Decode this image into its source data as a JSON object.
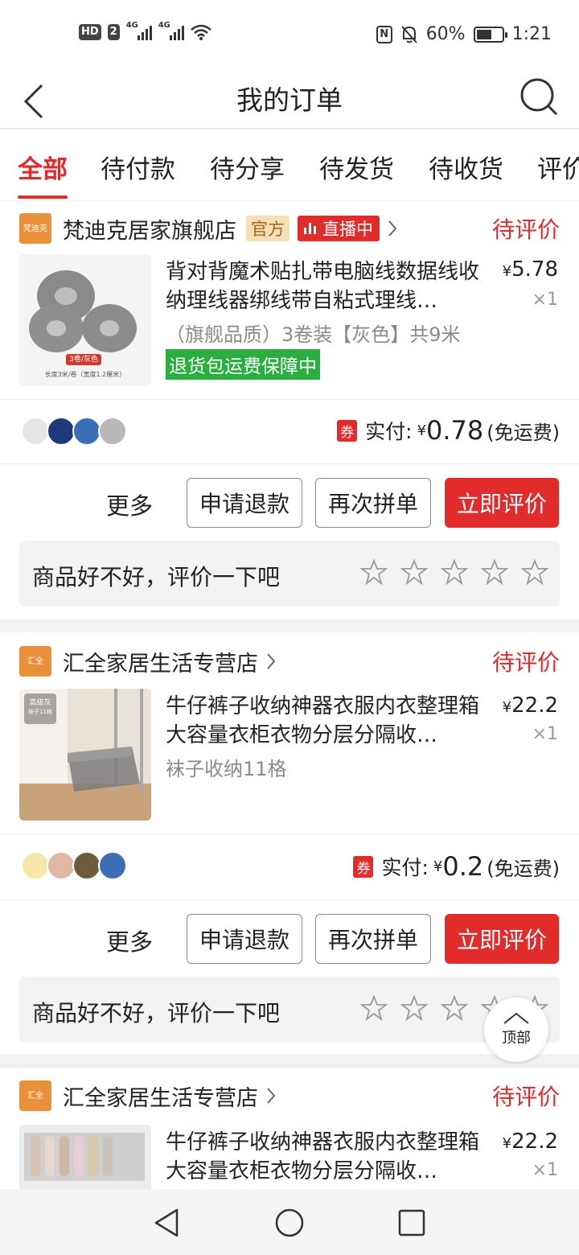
{
  "status_bar": {
    "hd": "HD",
    "hd_num": "2",
    "net1": "4G",
    "net2": "4G",
    "nfc": "N",
    "battery": "60%",
    "battery_level": 0.6,
    "time": "1:21"
  },
  "header": {
    "title": "我的订单",
    "back_icon": "back-arrow-icon",
    "search_icon": "search-icon"
  },
  "tabs": [
    {
      "label": "全部",
      "active": true
    },
    {
      "label": "待付款"
    },
    {
      "label": "待分享"
    },
    {
      "label": "待发货"
    },
    {
      "label": "待收货"
    },
    {
      "label": "评价"
    }
  ],
  "orders": [
    {
      "shop_logo_text": "梵迪克",
      "shop_name": "梵迪克居家旗舰店",
      "official_tag": "官方",
      "live_tag": "直播中",
      "status": "待评价",
      "title": "背对背魔术贴扎带电脑线数据线收纳理线器绑线带自粘式理线…",
      "spec": "（旗舰品质）3卷装【灰色】共9米",
      "guarantee": "退货包运费保障中",
      "price_symbol": "¥",
      "price": "5.78",
      "qty": "×1",
      "coupon": "券",
      "paid_label": "实付:",
      "paid_symbol": "¥",
      "paid_amount": "0.78",
      "paid_note": "(免运费)",
      "more": "更多",
      "refund": "申请退款",
      "regroup": "再次拼单",
      "review": "立即评价",
      "review_prompt": "商品好不好，评价一下吧",
      "thumb_badge": "3卷/灰色",
      "thumb_caption": "长度3米/卷（宽度1.2厘米）"
    },
    {
      "shop_logo_text": "汇全",
      "shop_name": "汇全家居生活专营店",
      "status": "待评价",
      "title": "牛仔裤子收纳神器衣服内衣整理箱大容量衣柜衣物分层分隔收…",
      "spec": "袜子收纳11格",
      "price_symbol": "¥",
      "price": "22.2",
      "qty": "×1",
      "coupon": "券",
      "paid_label": "实付:",
      "paid_symbol": "¥",
      "paid_amount": "0.2",
      "paid_note": "(免运费)",
      "more": "更多",
      "refund": "申请退款",
      "regroup": "再次拼单",
      "review": "立即评价",
      "review_prompt": "商品好不好，评价一下吧",
      "thumb_badge": "高级灰",
      "thumb_sub": "袜子11格"
    },
    {
      "shop_logo_text": "汇全",
      "shop_name": "汇全家居生活专营店",
      "status": "待评价",
      "title": "牛仔裤子收纳神器衣服内衣整理箱大容量衣柜衣物分层分隔收…",
      "price_symbol": "¥",
      "price": "22.2",
      "qty": "×1"
    }
  ],
  "to_top": "顶部",
  "colors": {
    "accent": "#e22c2c",
    "guarantee": "#2aae3f",
    "official_bg": "#f6dfb5",
    "shop_logo": "#e8903a"
  }
}
